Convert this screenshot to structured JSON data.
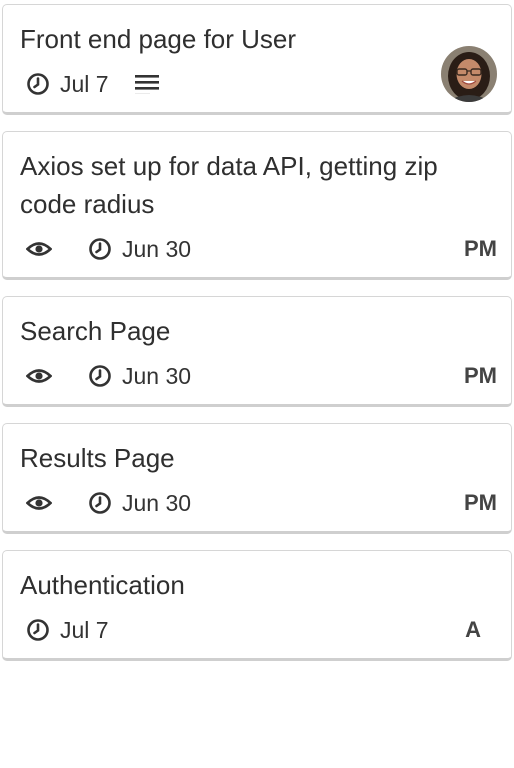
{
  "cards": [
    {
      "title": "Front end page for User",
      "due": "Jul 7",
      "has_watch": false,
      "has_description": true,
      "member": "",
      "has_avatar": true
    },
    {
      "title": "Axios set up for data API, getting zip code radius",
      "due": "Jun 30",
      "has_watch": true,
      "has_description": false,
      "member": "PM",
      "has_avatar": false
    },
    {
      "title": "Search Page",
      "due": "Jun 30",
      "has_watch": true,
      "has_description": false,
      "member": "PM",
      "has_avatar": false
    },
    {
      "title": "Results Page",
      "due": "Jun 30",
      "has_watch": true,
      "has_description": false,
      "member": "PM",
      "has_avatar": false
    },
    {
      "title": "Authentication",
      "due": "Jul 7",
      "has_watch": false,
      "has_description": false,
      "member": "A",
      "has_avatar": false
    }
  ],
  "icons": {
    "watch": "eye-icon",
    "due": "clock-icon",
    "description": "description-icon"
  },
  "colors": {
    "card_border": "#d6d6d6",
    "text": "#2f2f2f",
    "member_text": "#444444"
  }
}
